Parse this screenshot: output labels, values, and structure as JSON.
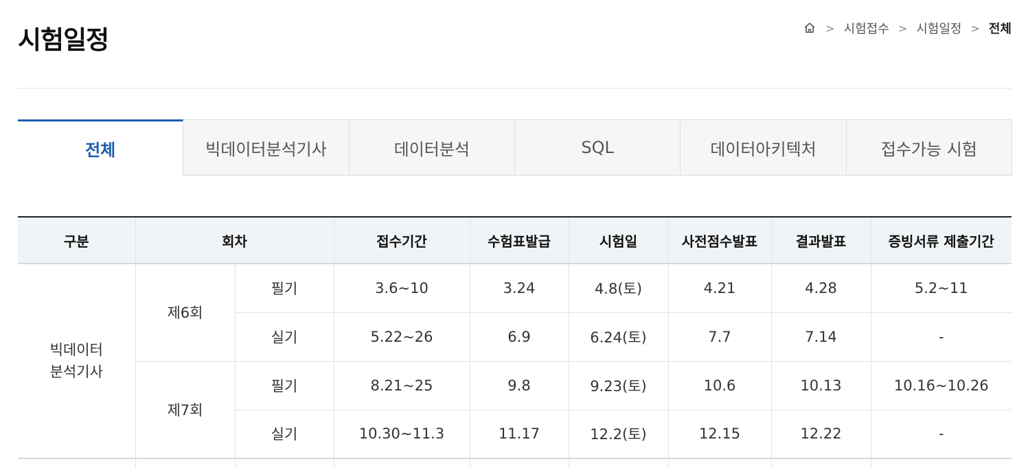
{
  "page": {
    "title": "시험일정"
  },
  "breadcrumb": {
    "home_icon": "home-icon",
    "items": [
      "시험접수",
      "시험일정"
    ],
    "current": "전체"
  },
  "tabs": [
    {
      "label": "전체",
      "active": true
    },
    {
      "label": "빅데이터분석기사",
      "active": false
    },
    {
      "label": "데이터분석",
      "active": false
    },
    {
      "label": "SQL",
      "active": false
    },
    {
      "label": "데이터아키텍처",
      "active": false
    },
    {
      "label": "접수가능 시험",
      "active": false
    }
  ],
  "colors": {
    "accent": "#1a5fae",
    "header_bg": "#f1f4f6"
  },
  "table": {
    "headers": [
      "구분",
      "회차",
      "접수기간",
      "수험표발급",
      "시험일",
      "사전점수발표",
      "결과발표",
      "증빙서류 제출기간"
    ],
    "category": {
      "line1": "빅데이터",
      "line2": "분석기사"
    },
    "rounds": [
      {
        "label": "제6회",
        "rows": [
          {
            "type": "필기",
            "reception": "3.6~10",
            "ticket": "3.24",
            "exam": "4.8(토)",
            "pre_score": "4.21",
            "result": "4.28",
            "documents": "5.2~11"
          },
          {
            "type": "실기",
            "reception": "5.22~26",
            "ticket": "6.9",
            "exam": "6.24(토)",
            "pre_score": "7.7",
            "result": "7.14",
            "documents": "-"
          }
        ]
      },
      {
        "label": "제7회",
        "rows": [
          {
            "type": "필기",
            "reception": "8.21~25",
            "ticket": "9.8",
            "exam": "9.23(토)",
            "pre_score": "10.6",
            "result": "10.13",
            "documents": "10.16~10.26"
          },
          {
            "type": "실기",
            "reception": "10.30~11.3",
            "ticket": "11.17",
            "exam": "12.2(토)",
            "pre_score": "12.15",
            "result": "12.22",
            "documents": "-"
          }
        ]
      }
    ]
  }
}
